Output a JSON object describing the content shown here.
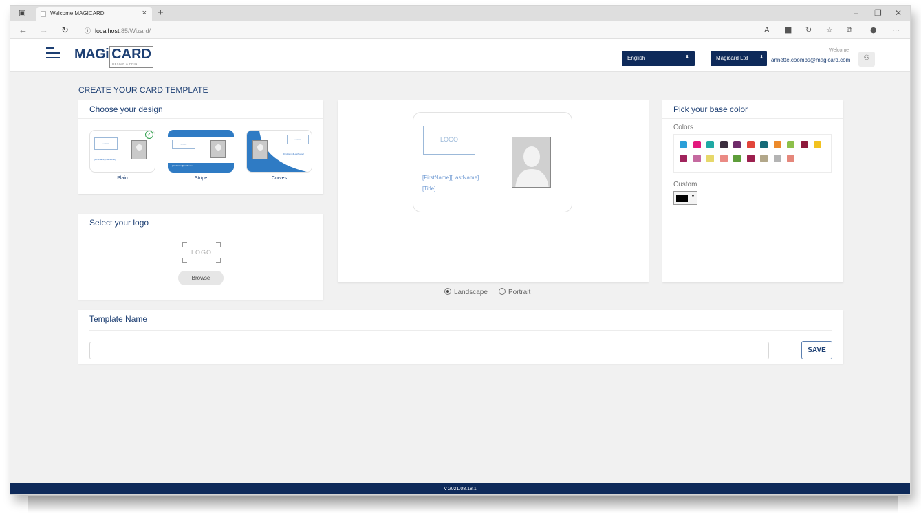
{
  "browser": {
    "tab_title": "Welcome MAGICARD",
    "tab_close": "×",
    "new_tab": "+",
    "url_host": "localhost",
    "url_path": ":85/Wizard/",
    "window_minimize": "–",
    "window_restore": "❐",
    "window_close": "✕"
  },
  "header": {
    "logo_magi": "MAGi",
    "logo_card": "CARD",
    "logo_sub": "DESIGN & PRINT",
    "language": "English",
    "company": "Magicard Ltd",
    "welcome": "Welcome",
    "email": "annette.coombs@magicard.com"
  },
  "page": {
    "title": "CREATE YOUR CARD TEMPLATE"
  },
  "design_panel": {
    "title": "Choose your design",
    "options": [
      {
        "label": "Plain",
        "selected": true
      },
      {
        "label": "Stripe",
        "selected": false
      },
      {
        "label": "Curves",
        "selected": false
      }
    ],
    "mini_logo": "LOGO",
    "mini_text": "[FirstName][LastName]"
  },
  "logo_panel": {
    "title": "Select your logo",
    "placeholder": "LOGO",
    "browse_label": "Browse"
  },
  "preview": {
    "logo_text": "LOGO",
    "name_field": "[FirstName][LastName]",
    "title_field": "[Title]"
  },
  "orientation": {
    "options": [
      {
        "label": "Landscape",
        "checked": true
      },
      {
        "label": "Portrait",
        "checked": false
      }
    ]
  },
  "color_panel": {
    "title": "Pick your base color",
    "colors_label": "Colors",
    "custom_label": "Custom",
    "custom_color": "#000000",
    "swatches": [
      "#2b9fd8",
      "#e3197d",
      "#1fa9a4",
      "#3b2e3e",
      "#6f2b6a",
      "#e2453a",
      "#156a78",
      "#ec8a2b",
      "#8dc04a",
      "#8e1a3c",
      "#f2c21f",
      "#a0235c",
      "#c56aa0",
      "#e7d86a",
      "#ea8a84",
      "#5d9d3a",
      "#9c1f4e",
      "#b2a78a",
      "#b4b4b4",
      "#e5877b"
    ]
  },
  "template_panel": {
    "title": "Template Name",
    "input_value": "",
    "save_label": "SAVE"
  },
  "footer": {
    "version": "V 2021.08.18.1"
  }
}
